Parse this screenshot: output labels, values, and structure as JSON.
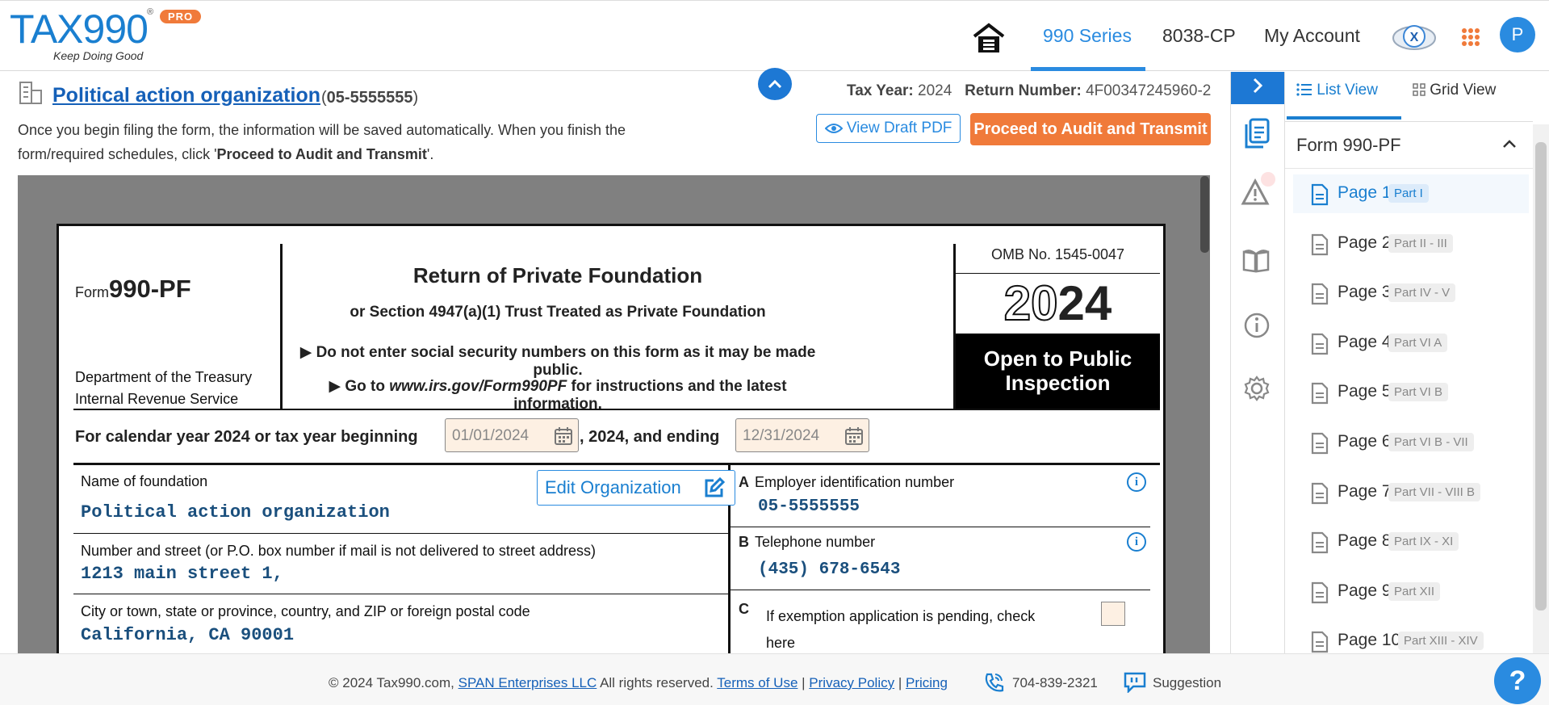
{
  "header": {
    "logo": "TAX990",
    "logo_tagline": "Keep Doing Good",
    "logo_badge": "PRO",
    "nav": [
      "990 Series",
      "8038-CP",
      "My Account"
    ],
    "active_nav": "990 Series",
    "avatar_letter": "P"
  },
  "subheader": {
    "org_name": "Political action organization",
    "org_ein_open": "(",
    "org_ein": "05-5555555",
    "org_ein_close": ")",
    "note_pre": "Once you begin filing the form, the information will be saved automatically. When you finish the form/required schedules, click '",
    "note_bold": "Proceed to Audit and Transmit",
    "note_post": "'.",
    "tax_year_label": "Tax Year:",
    "tax_year": "2024",
    "return_number_label": "Return Number:",
    "return_number": "4F00347245960-2",
    "view_draft_label": "View Draft PDF",
    "proceed_label": "Proceed to Audit and Transmit"
  },
  "form": {
    "form_word": "Form",
    "form_number": "990-PF",
    "dept_line1": "Department of the Treasury",
    "dept_line2": "Internal Revenue Service",
    "title": "Return of Private Foundation",
    "subtitle": "or Section 4947(a)(1) Trust Treated as Private Foundation",
    "instr1": "▶ Do not enter social security numbers on this form as it may be made public.",
    "instr2_pre": "▶ Go to ",
    "instr2_link": "www.irs.gov/Form990PF",
    "instr2_post": " for instructions and the latest information.",
    "omb": "OMB No. 1545-0047",
    "year_outline": "20",
    "year_solid": "24",
    "open_public_line1": "Open to Public",
    "open_public_line2": "Inspection",
    "calendar_label": "For calendar year 2024 or tax year beginning",
    "begin_date": "01/01/2024",
    "and_ending": ", 2024, and ending",
    "end_date": "12/31/2024",
    "name_label": "Name of foundation",
    "name_value": "Political action organization",
    "edit_org_label": "Edit Organization",
    "street_label": "Number and street (or P.O. box number if mail is not delivered to street address)",
    "street_value": "1213 main street 1,",
    "city_label": "City or town, state or province, country, and ZIP or foreign postal code",
    "city_value": "California, CA 90001",
    "a_letter": "A",
    "ein_label": "Employer identification number",
    "ein_value": "05-5555555",
    "b_letter": "B",
    "phone_label": "Telephone number",
    "phone_value": "(435) 678-6543",
    "c_letter": "C",
    "exemption_label_line1": "If exemption application is pending, check",
    "exemption_label_line2": "here"
  },
  "right_panel": {
    "list_view": "List View",
    "grid_view": "Grid View",
    "form_header": "Form 990-PF",
    "pages": [
      {
        "name": "Page 1",
        "badge": "Part I",
        "active": true
      },
      {
        "name": "Page 2",
        "badge": "Part II - III"
      },
      {
        "name": "Page 3",
        "badge": "Part IV - V"
      },
      {
        "name": "Page 4",
        "badge": "Part VI A"
      },
      {
        "name": "Page 5",
        "badge": "Part VI B"
      },
      {
        "name": "Page 6",
        "badge": "Part VI B - VII"
      },
      {
        "name": "Page 7",
        "badge": "Part VII - VIII B"
      },
      {
        "name": "Page 8",
        "badge": "Part IX - XI"
      },
      {
        "name": "Page 9",
        "badge": "Part XII"
      },
      {
        "name": "Page 10",
        "badge": "Part XIII - XIV"
      }
    ]
  },
  "footer": {
    "copyright": "© 2024 Tax990.com,",
    "span_link": "SPAN Enterprises LLC",
    "rights": "All rights reserved.",
    "terms": "Terms of Use",
    "privacy": "Privacy Policy",
    "pricing": "Pricing",
    "sep": "|",
    "phone": "704-839-2321",
    "suggestion": "Suggestion",
    "help": "?"
  },
  "icons": [
    "home-icon",
    "apps-grid-icon",
    "building-icon",
    "eye-icon",
    "calendar-icon",
    "edit-icon",
    "info-icon",
    "chevron-right-icon",
    "chevron-up-icon",
    "form-doc-icon",
    "warning-icon",
    "book-icon",
    "settings-icon",
    "list-icon",
    "grid-icon",
    "page-icon",
    "phone-icon",
    "chat-icon"
  ],
  "colors": {
    "brand_blue": "#2a8be0",
    "orange": "#f07a3a",
    "dark_blue_text": "#1560b8"
  }
}
